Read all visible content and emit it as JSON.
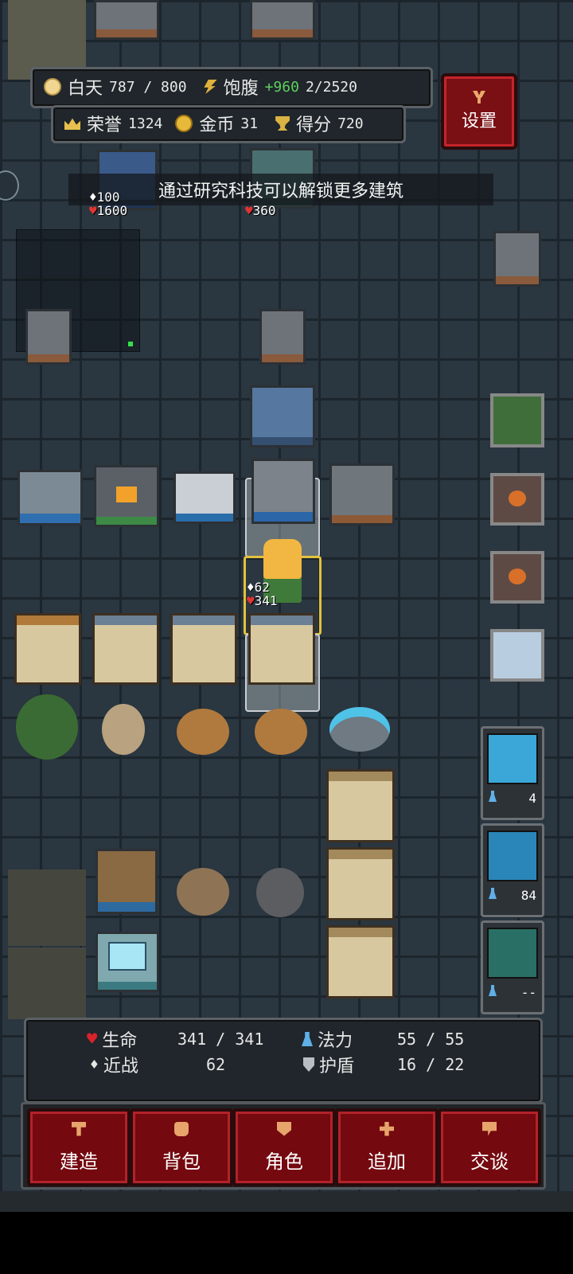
{
  "hud": {
    "day_label": "白天",
    "day_value": "787 / 800",
    "satiety_label": "饱腹",
    "satiety_value": "2/2520",
    "satiety_popup": "+960",
    "honor_label": "荣誉",
    "honor_value": "1324",
    "gold_label": "金币",
    "gold_value": "31",
    "score_label": "得分",
    "score_value": "720",
    "settings_label": "设置"
  },
  "tip": "通过研究科技可以解锁更多建筑",
  "unit_labels": {
    "tower_left_atk": "100",
    "tower_left_hp": "1600",
    "tower_mid_hp": "360",
    "hero_atk": "62",
    "hero_hp": "341"
  },
  "skills": [
    {
      "name": "lightning",
      "cost": "4",
      "color": "#3aa7d8"
    },
    {
      "name": "rune",
      "cost": "84",
      "color": "#2a86b8"
    },
    {
      "name": "shield",
      "cost": "--",
      "color": "#2a6f66"
    }
  ],
  "stats": {
    "hp_label": "生命",
    "hp_value": "341 / 341",
    "mana_label": "法力",
    "mana_value": "55 / 55",
    "melee_label": "近战",
    "melee_value": "62",
    "shield_label": "护盾",
    "shield_value": "16 / 22"
  },
  "nav": [
    {
      "label": "建造",
      "icon": "hammer-icon"
    },
    {
      "label": "背包",
      "icon": "bag-icon"
    },
    {
      "label": "角色",
      "icon": "character-icon"
    },
    {
      "label": "追加",
      "icon": "plus-icon"
    },
    {
      "label": "交谈",
      "icon": "chat-icon"
    }
  ]
}
